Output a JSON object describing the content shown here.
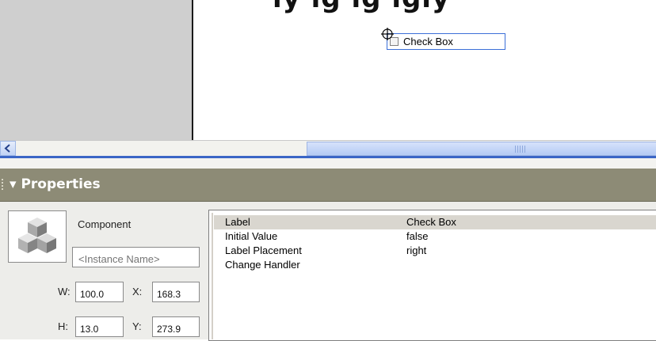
{
  "stage": {
    "heading_fragment": "ıy ıg ıg ıgıy",
    "checkbox_label": "Check Box"
  },
  "scrollbar": {
    "left_arrow": "<"
  },
  "properties_panel": {
    "title": "▾ Properties",
    "component_type": "Component",
    "instance_name_placeholder": "<Instance Name>",
    "w_label": "W:",
    "w_value": "100.0",
    "x_label": "X:",
    "x_value": "168.3",
    "h_label": "H:",
    "h_value": "13.0",
    "y_label": "Y:",
    "y_value": "273.9",
    "parameters": [
      {
        "name": "Label",
        "value": "Check Box"
      },
      {
        "name": "Initial Value",
        "value": "false"
      },
      {
        "name": "Label Placement",
        "value": "right"
      },
      {
        "name": "Change Handler",
        "value": ""
      }
    ]
  },
  "icons": {
    "component": "component-cubes-icon",
    "registration_point": "crosshair-icon",
    "scroll_left": "arrow-left-icon",
    "scroll_grip": "grip-icon"
  }
}
